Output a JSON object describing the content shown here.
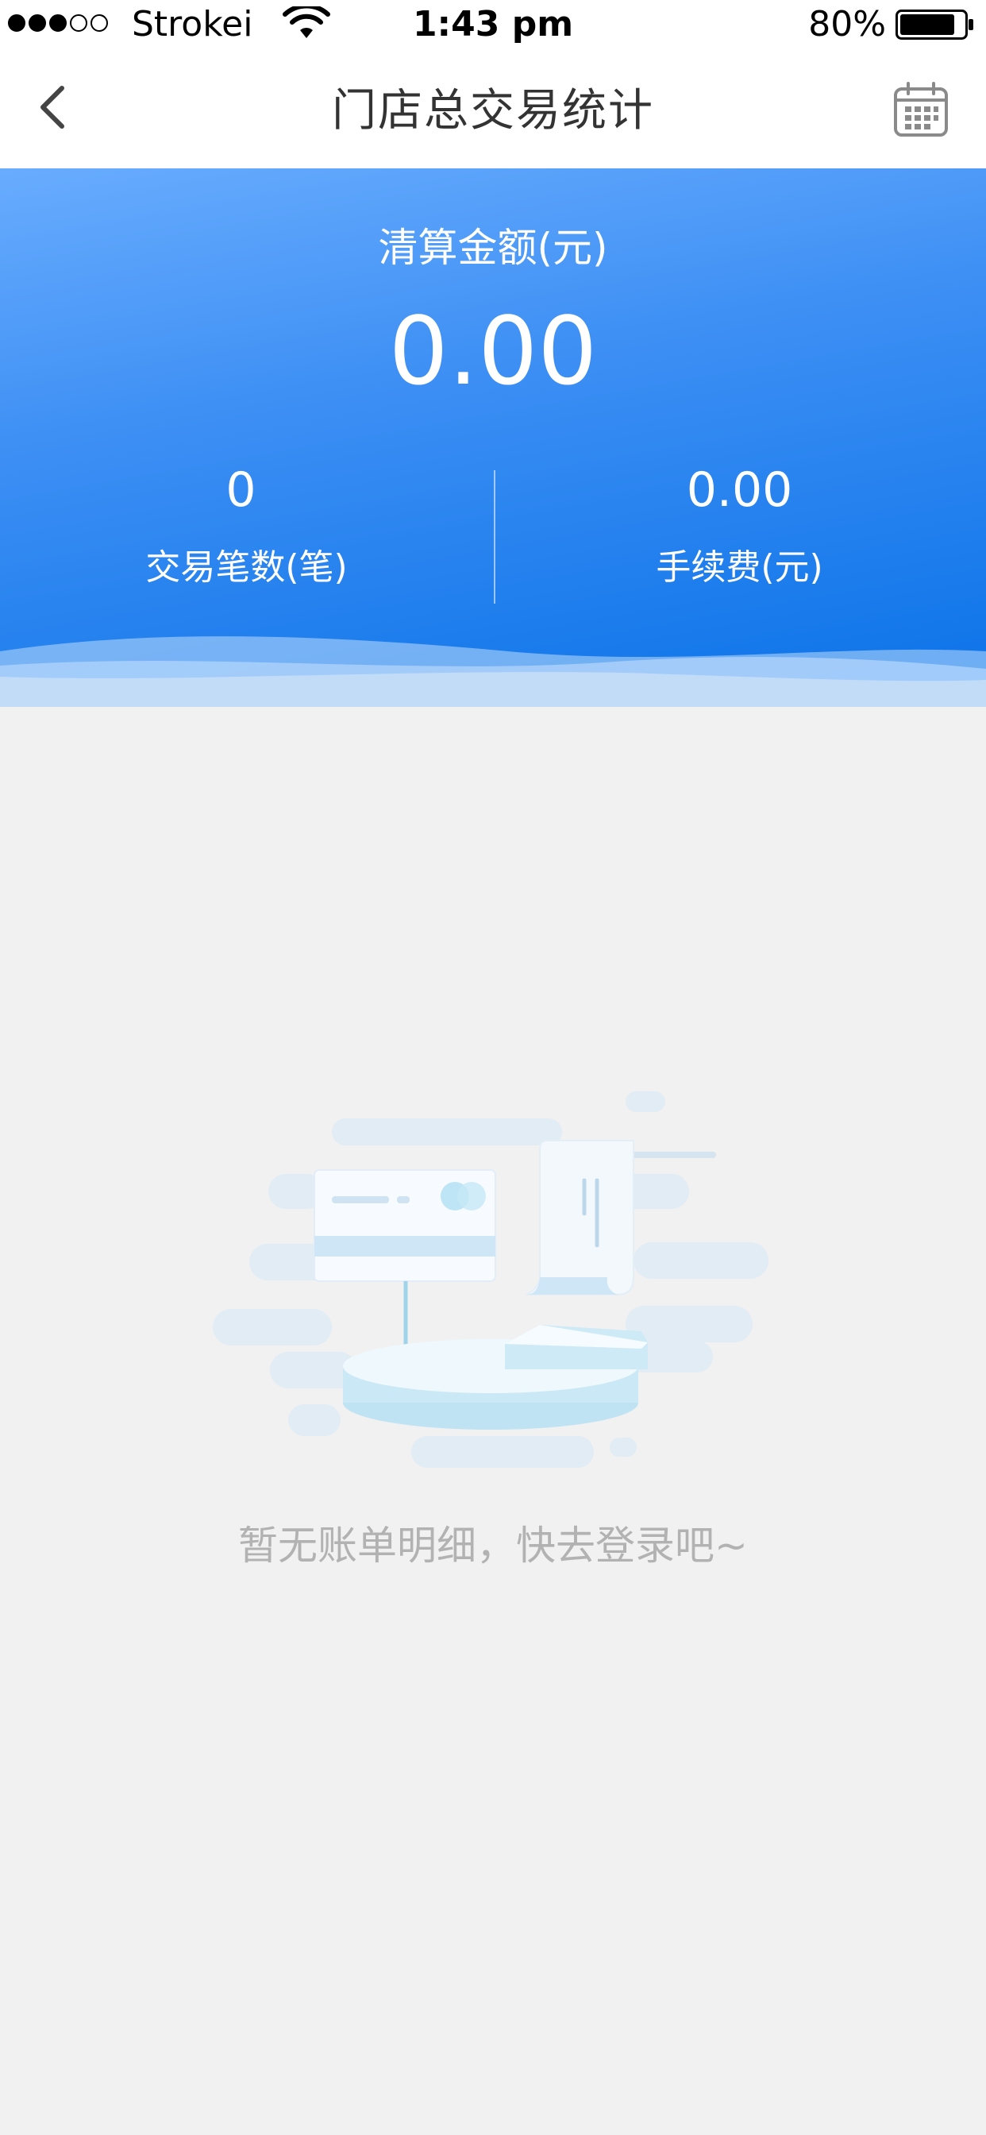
{
  "status_bar": {
    "carrier": "Strokei",
    "time": "1:43 pm",
    "battery": "80%",
    "signal_bars_filled": 3,
    "signal_bars_total": 5,
    "battery_level": 0.8
  },
  "nav": {
    "title": "门店总交易统计",
    "back_icon": "chevron-left-icon",
    "calendar_icon": "calendar-icon"
  },
  "summary": {
    "settlement_label": "清算金额(元)",
    "settlement_amount": "0.00",
    "transaction_count": "0",
    "transaction_count_label": "交易笔数(笔)",
    "fee_amount": "0.00",
    "fee_label": "手续费(元)"
  },
  "empty_state": {
    "message": "暂无账单明细，快去登录吧~",
    "illustration": "card-and-receipt-illustration"
  },
  "colors": {
    "header_gradient_start": "#68acfe",
    "header_gradient_end": "#0a72e8",
    "page_background": "#f1f1f1",
    "empty_text": "#b2b2b2"
  }
}
